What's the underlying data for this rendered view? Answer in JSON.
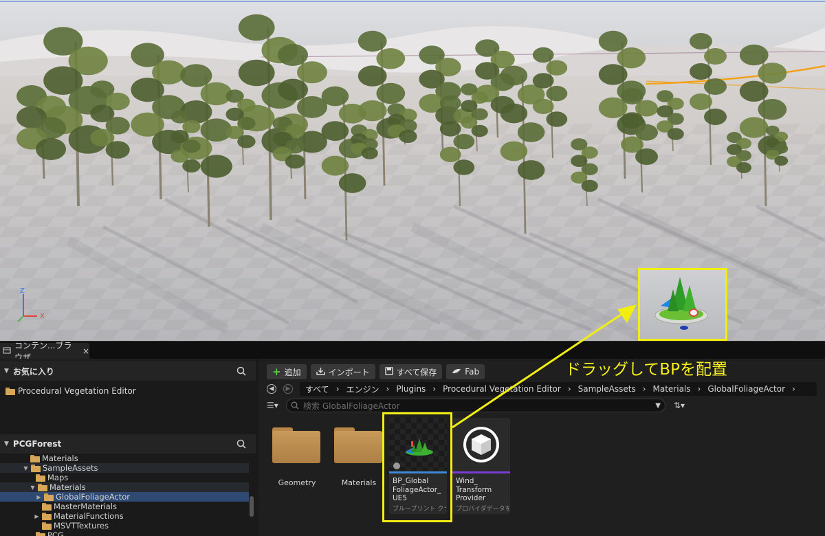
{
  "viewport": {
    "gizmo": {
      "z_label": "Z",
      "x_label": "X"
    },
    "colors": {
      "highlight": "#f2ee12",
      "selection_line": "#2f6fd8"
    }
  },
  "browser_tab": {
    "label": "コンテン...ブラウザ",
    "close": "×"
  },
  "favorites": {
    "title": "お気に入り",
    "items": [
      {
        "label": "Procedural Vegetation Editor"
      }
    ]
  },
  "project": {
    "title": "PCGForest",
    "tree": [
      {
        "label": "Materials"
      },
      {
        "label": "SampleAssets"
      },
      {
        "label": "Maps"
      },
      {
        "label": "Materials"
      },
      {
        "label": "GlobalFoliageActor"
      },
      {
        "label": "MasterMaterials"
      },
      {
        "label": "MaterialFunctions"
      },
      {
        "label": "MSVTTextures"
      },
      {
        "label": "PCG"
      }
    ]
  },
  "toolbar": {
    "add": "追加",
    "import": "インポート",
    "save_all": "すべて保存",
    "fab": "Fab"
  },
  "breadcrumbs": [
    "すべて",
    "エンジン",
    "Plugins",
    "Procedural Vegetation Editor",
    "SampleAssets",
    "Materials",
    "GlobalFoliageActor"
  ],
  "search": {
    "placeholder": "検索 GlobalFoliageActor"
  },
  "assets": [
    {
      "label": "Geometry"
    },
    {
      "label": "Materials"
    },
    {
      "name": "BP_Global FoliageActor_ UE5",
      "type": "ブループリント クラス",
      "bar_color": "#3d8ad8"
    },
    {
      "name": "Wind_ Transform Provider",
      "type": "プロバイダデータを...",
      "bar_color": "#7a3dd6"
    }
  ],
  "annotation": {
    "text": "ドラッグしてBPを配置"
  }
}
